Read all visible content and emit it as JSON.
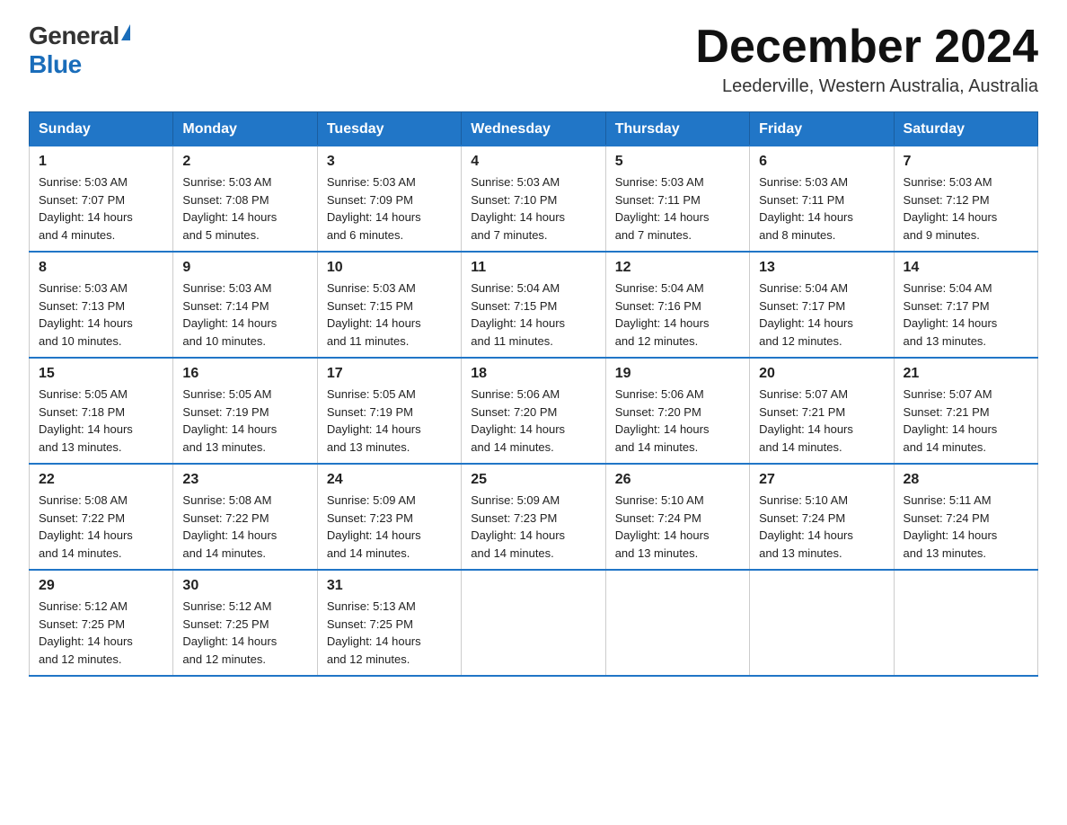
{
  "header": {
    "logo_general": "General",
    "logo_blue": "Blue",
    "month_title": "December 2024",
    "subtitle": "Leederville, Western Australia, Australia"
  },
  "days_of_week": [
    "Sunday",
    "Monday",
    "Tuesday",
    "Wednesday",
    "Thursday",
    "Friday",
    "Saturday"
  ],
  "weeks": [
    [
      {
        "day": "1",
        "sunrise": "5:03 AM",
        "sunset": "7:07 PM",
        "daylight": "14 hours and 4 minutes."
      },
      {
        "day": "2",
        "sunrise": "5:03 AM",
        "sunset": "7:08 PM",
        "daylight": "14 hours and 5 minutes."
      },
      {
        "day": "3",
        "sunrise": "5:03 AM",
        "sunset": "7:09 PM",
        "daylight": "14 hours and 6 minutes."
      },
      {
        "day": "4",
        "sunrise": "5:03 AM",
        "sunset": "7:10 PM",
        "daylight": "14 hours and 7 minutes."
      },
      {
        "day": "5",
        "sunrise": "5:03 AM",
        "sunset": "7:11 PM",
        "daylight": "14 hours and 7 minutes."
      },
      {
        "day": "6",
        "sunrise": "5:03 AM",
        "sunset": "7:11 PM",
        "daylight": "14 hours and 8 minutes."
      },
      {
        "day": "7",
        "sunrise": "5:03 AM",
        "sunset": "7:12 PM",
        "daylight": "14 hours and 9 minutes."
      }
    ],
    [
      {
        "day": "8",
        "sunrise": "5:03 AM",
        "sunset": "7:13 PM",
        "daylight": "14 hours and 10 minutes."
      },
      {
        "day": "9",
        "sunrise": "5:03 AM",
        "sunset": "7:14 PM",
        "daylight": "14 hours and 10 minutes."
      },
      {
        "day": "10",
        "sunrise": "5:03 AM",
        "sunset": "7:15 PM",
        "daylight": "14 hours and 11 minutes."
      },
      {
        "day": "11",
        "sunrise": "5:04 AM",
        "sunset": "7:15 PM",
        "daylight": "14 hours and 11 minutes."
      },
      {
        "day": "12",
        "sunrise": "5:04 AM",
        "sunset": "7:16 PM",
        "daylight": "14 hours and 12 minutes."
      },
      {
        "day": "13",
        "sunrise": "5:04 AM",
        "sunset": "7:17 PM",
        "daylight": "14 hours and 12 minutes."
      },
      {
        "day": "14",
        "sunrise": "5:04 AM",
        "sunset": "7:17 PM",
        "daylight": "14 hours and 13 minutes."
      }
    ],
    [
      {
        "day": "15",
        "sunrise": "5:05 AM",
        "sunset": "7:18 PM",
        "daylight": "14 hours and 13 minutes."
      },
      {
        "day": "16",
        "sunrise": "5:05 AM",
        "sunset": "7:19 PM",
        "daylight": "14 hours and 13 minutes."
      },
      {
        "day": "17",
        "sunrise": "5:05 AM",
        "sunset": "7:19 PM",
        "daylight": "14 hours and 13 minutes."
      },
      {
        "day": "18",
        "sunrise": "5:06 AM",
        "sunset": "7:20 PM",
        "daylight": "14 hours and 14 minutes."
      },
      {
        "day": "19",
        "sunrise": "5:06 AM",
        "sunset": "7:20 PM",
        "daylight": "14 hours and 14 minutes."
      },
      {
        "day": "20",
        "sunrise": "5:07 AM",
        "sunset": "7:21 PM",
        "daylight": "14 hours and 14 minutes."
      },
      {
        "day": "21",
        "sunrise": "5:07 AM",
        "sunset": "7:21 PM",
        "daylight": "14 hours and 14 minutes."
      }
    ],
    [
      {
        "day": "22",
        "sunrise": "5:08 AM",
        "sunset": "7:22 PM",
        "daylight": "14 hours and 14 minutes."
      },
      {
        "day": "23",
        "sunrise": "5:08 AM",
        "sunset": "7:22 PM",
        "daylight": "14 hours and 14 minutes."
      },
      {
        "day": "24",
        "sunrise": "5:09 AM",
        "sunset": "7:23 PM",
        "daylight": "14 hours and 14 minutes."
      },
      {
        "day": "25",
        "sunrise": "5:09 AM",
        "sunset": "7:23 PM",
        "daylight": "14 hours and 14 minutes."
      },
      {
        "day": "26",
        "sunrise": "5:10 AM",
        "sunset": "7:24 PM",
        "daylight": "14 hours and 13 minutes."
      },
      {
        "day": "27",
        "sunrise": "5:10 AM",
        "sunset": "7:24 PM",
        "daylight": "14 hours and 13 minutes."
      },
      {
        "day": "28",
        "sunrise": "5:11 AM",
        "sunset": "7:24 PM",
        "daylight": "14 hours and 13 minutes."
      }
    ],
    [
      {
        "day": "29",
        "sunrise": "5:12 AM",
        "sunset": "7:25 PM",
        "daylight": "14 hours and 12 minutes."
      },
      {
        "day": "30",
        "sunrise": "5:12 AM",
        "sunset": "7:25 PM",
        "daylight": "14 hours and 12 minutes."
      },
      {
        "day": "31",
        "sunrise": "5:13 AM",
        "sunset": "7:25 PM",
        "daylight": "14 hours and 12 minutes."
      },
      null,
      null,
      null,
      null
    ]
  ],
  "labels": {
    "sunrise": "Sunrise:",
    "sunset": "Sunset:",
    "daylight": "Daylight:"
  }
}
